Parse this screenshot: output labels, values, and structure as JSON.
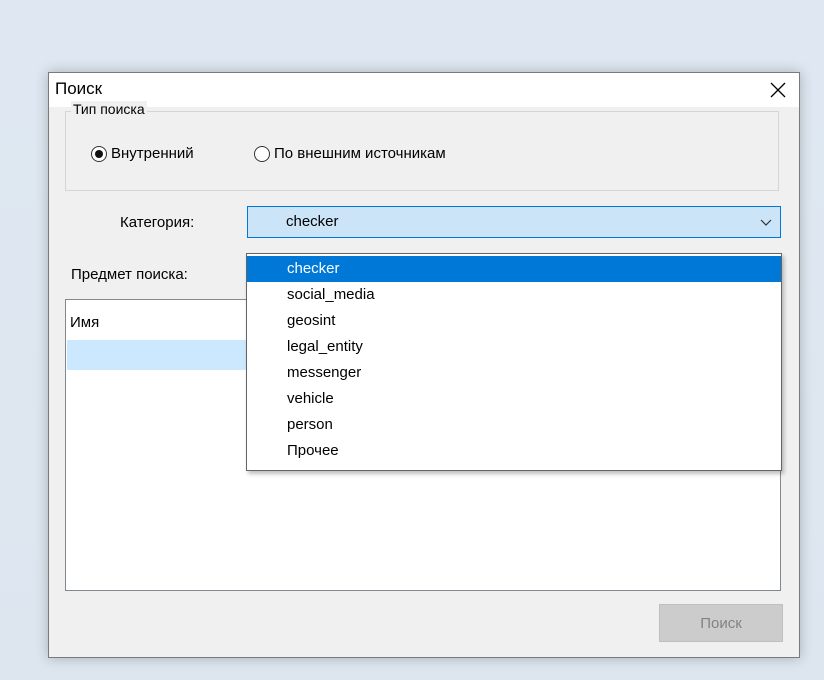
{
  "dialog": {
    "title": "Поиск",
    "close_label": "×"
  },
  "search_type": {
    "legend": "Тип поиска",
    "options": [
      {
        "label": "Внутренний",
        "selected": true
      },
      {
        "label": "По внешним источникам",
        "selected": false
      }
    ]
  },
  "category": {
    "label": "Категория:",
    "value": "checker",
    "options": [
      "checker",
      "social_media",
      "geosint",
      "legal_entity",
      "messenger",
      "vehicle",
      "person",
      "Прочее"
    ],
    "highlighted_index": 0
  },
  "subject": {
    "label": "Предмет поиска:"
  },
  "list": {
    "column_header": "Имя"
  },
  "actions": {
    "search_label": "Поиск",
    "search_enabled": false
  },
  "colors": {
    "accent": "#0078d7",
    "combo_bg": "#cce4f7",
    "selection_bg": "#cce8ff"
  }
}
